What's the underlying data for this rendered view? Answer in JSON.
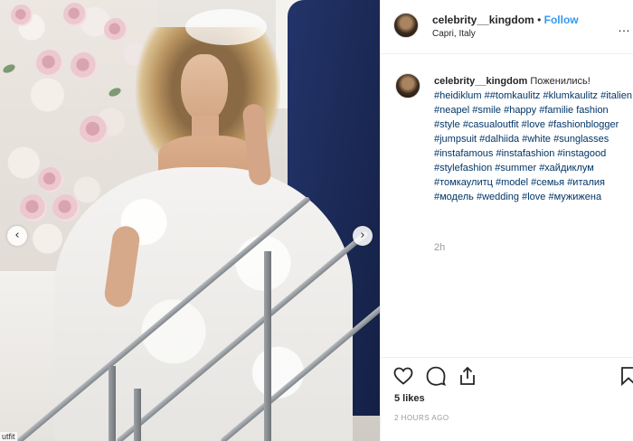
{
  "header": {
    "username": "celebrity__kingdom",
    "separator": "•",
    "follow_label": "Follow",
    "location": "Capri, Italy",
    "more_icon": "ellipsis-icon"
  },
  "caption": {
    "username": "celebrity__kingdom",
    "text": "Поженились!",
    "hashtags": [
      "#heidiklum",
      "##tomkaulitz",
      "#klumkaulitz",
      "#italien",
      "#neapel",
      "#smile",
      "#happy",
      "#familie",
      "fashion",
      "#style",
      "#casualoutfit",
      "#love",
      "#fashionblogger",
      "#jumpsuit",
      "#dalhiida",
      "#white",
      "#sunglasses",
      "#instafamous",
      "#instafashion",
      "#instagood",
      "#stylefashion",
      "#summer",
      "#хайдиклум",
      "#томкаулитц",
      "#model",
      "#семья",
      "#италия",
      "#модель",
      "#wedding",
      "#love",
      "#мужижена"
    ],
    "time": "2h"
  },
  "actions": {
    "like_icon": "heart-icon",
    "comment_icon": "comment-icon",
    "share_icon": "share-icon",
    "save_icon": "bookmark-icon",
    "likes": "5 likes",
    "posted": "2 HOURS AGO"
  },
  "photo": {
    "prev_arrow": "‹",
    "next_arrow": "›",
    "corner_text": "utfit"
  },
  "colors": {
    "link_blue": "#3897f0",
    "hashtag": "#003569",
    "muted": "#999999",
    "text": "#262626"
  }
}
